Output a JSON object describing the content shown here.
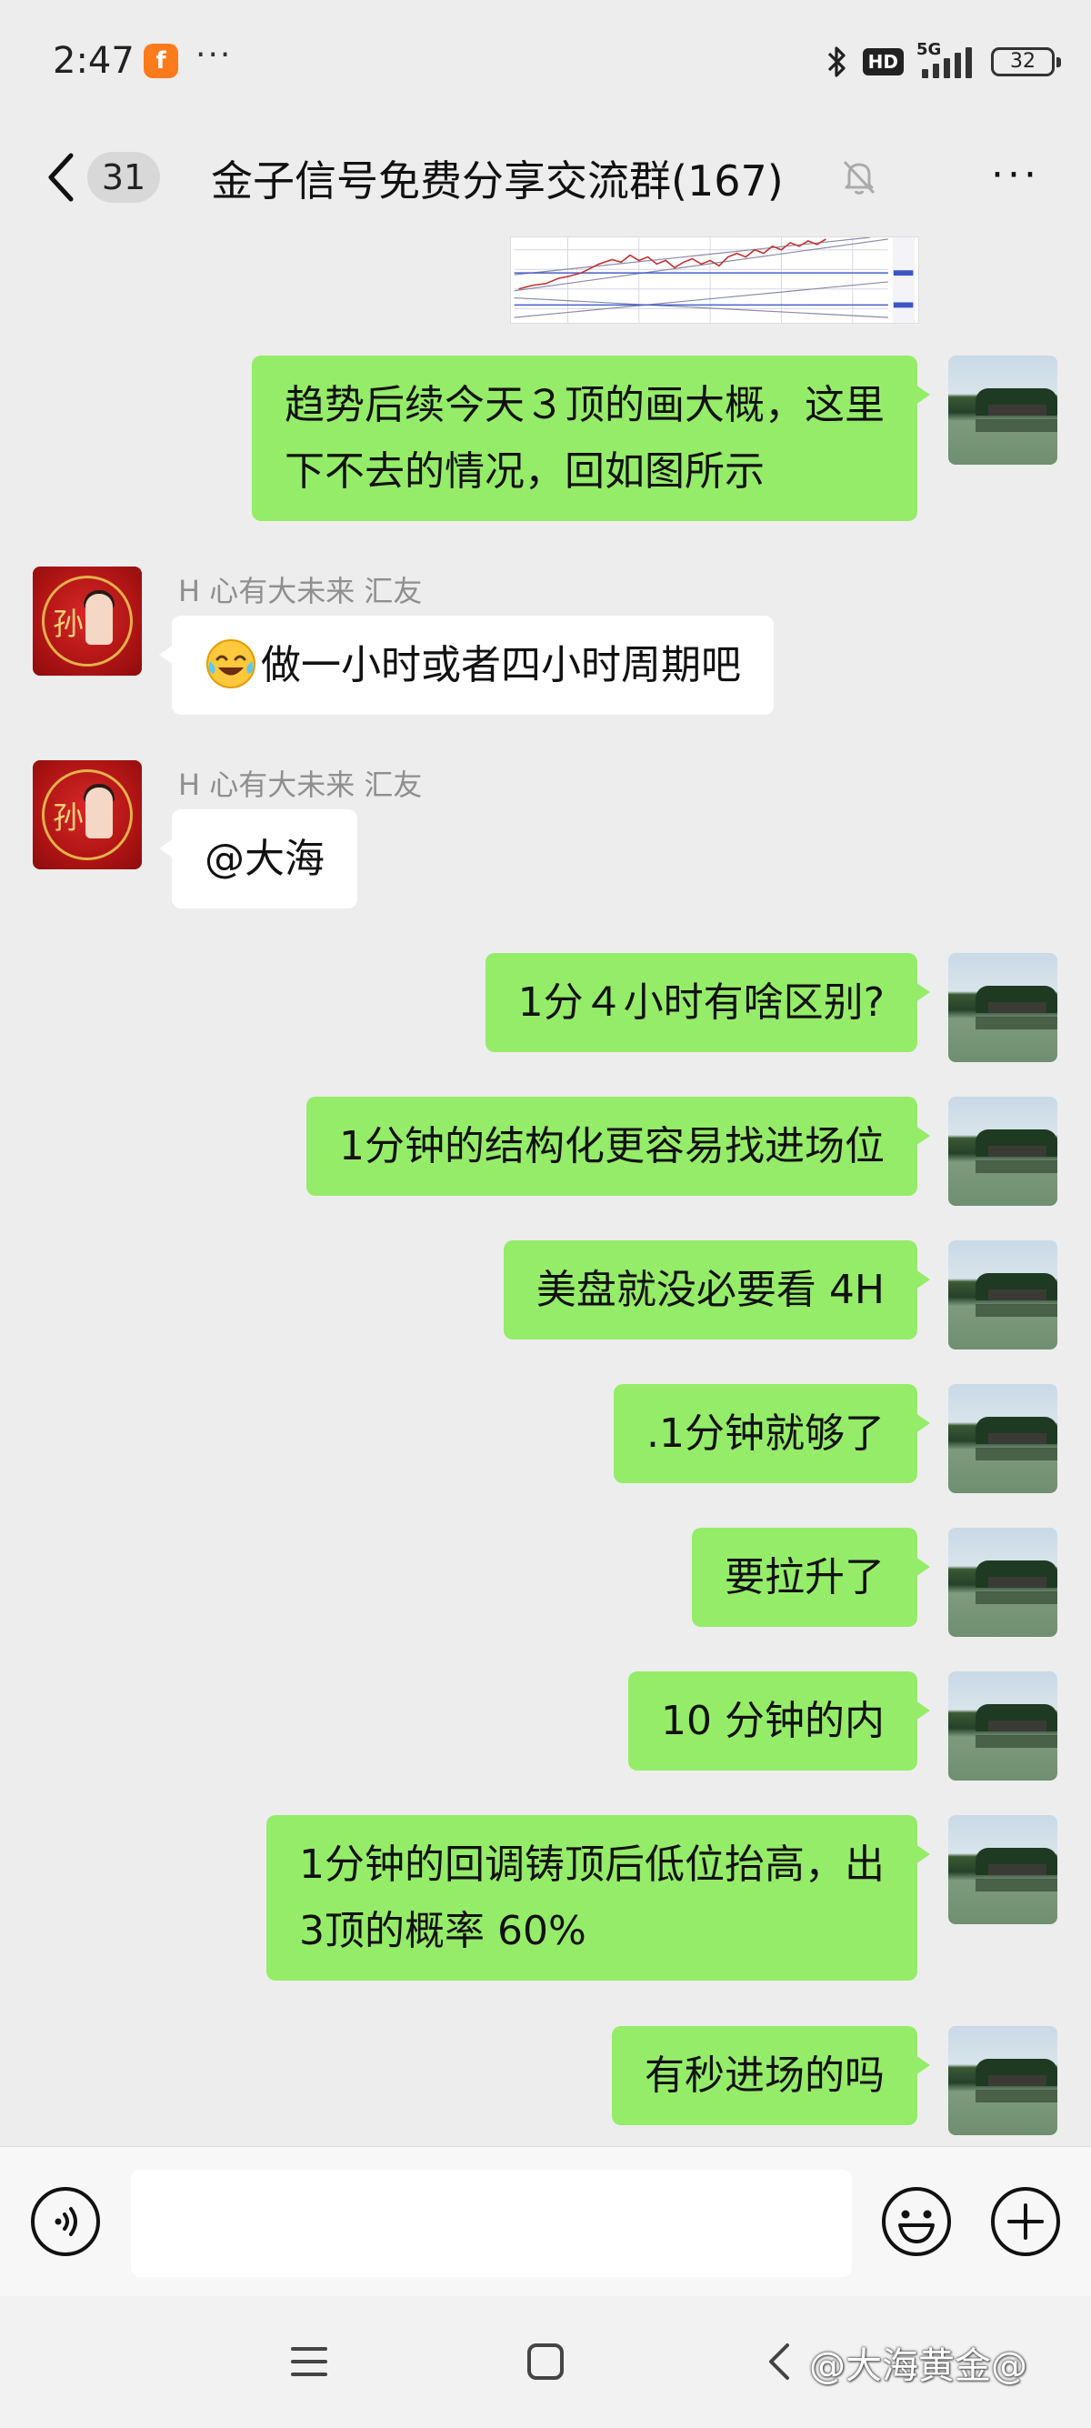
{
  "status_bar": {
    "time": "2:47",
    "app_icon_glyph": "f",
    "more": "···",
    "hd": "HD",
    "network": "5G",
    "battery": "32"
  },
  "header": {
    "unread_count": "31",
    "title": "金子信号免费分享交流群(167)",
    "more": "···"
  },
  "other_user": {
    "name": "H 心有大未来 汇友",
    "avatar_char": "孙"
  },
  "messages": [
    {
      "side": "me",
      "text_lines": [
        "趋势后续今天３顶的画大概，这里",
        "下不去的情况，回如图所示"
      ]
    },
    {
      "side": "them",
      "text": "做一小时或者四小时周期吧",
      "emoji": "face-with-tears-of-joy"
    },
    {
      "side": "them",
      "text": "@大海"
    },
    {
      "side": "me",
      "text": "1分４小时有啥区别?"
    },
    {
      "side": "me",
      "text": "1分钟的结构化更容易找进场位"
    },
    {
      "side": "me",
      "text": "美盘就没必要看 4H"
    },
    {
      "side": "me",
      "text": ".1分钟就够了"
    },
    {
      "side": "me",
      "text": "要拉升了"
    },
    {
      "side": "me",
      "text": "10 分钟的内"
    },
    {
      "side": "me",
      "text_lines": [
        "1分钟的回调铸顶后低位抬高，出",
        "3顶的概率 60%"
      ]
    },
    {
      "side": "me",
      "text": "有秒进场的吗"
    }
  ],
  "input": {
    "value": "",
    "placeholder": ""
  },
  "watermark": "@大海黄金@",
  "colors": {
    "background": "#ededed",
    "my_bubble": "#95ec69",
    "their_bubble": "#ffffff",
    "name_text": "#8f8f8f"
  },
  "icons": [
    "bluetooth-icon",
    "signal-icon",
    "battery-icon",
    "back-icon",
    "mute-bell-icon",
    "voice-icon",
    "emoji-icon",
    "plus-icon",
    "nav-menu-icon",
    "nav-home-icon",
    "nav-back-icon"
  ]
}
